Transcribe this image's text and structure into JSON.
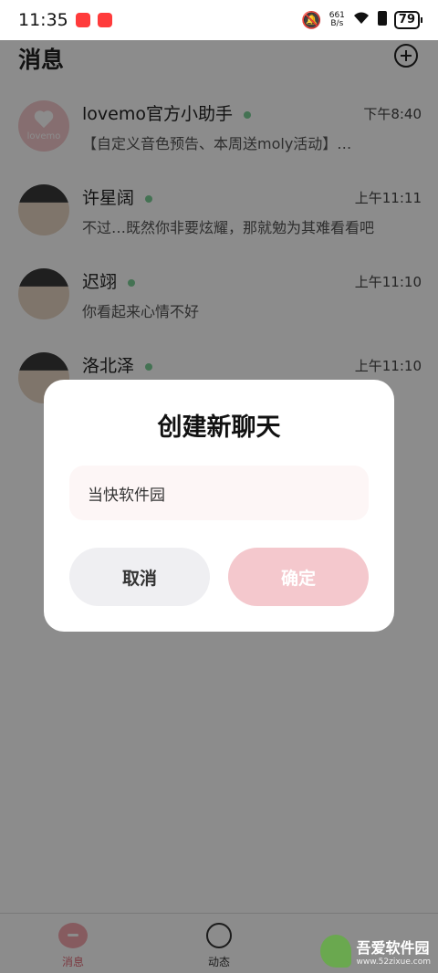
{
  "status_bar": {
    "time": "11:35",
    "net_speed_value": "661",
    "net_speed_unit": "B/s",
    "battery": "79"
  },
  "header": {
    "title": "消息",
    "add_icon": "plus-circle-icon"
  },
  "chats": [
    {
      "name": "lovemo官方小助手",
      "time": "下午8:40",
      "preview": "【自定义音色预告、本周送moly活动】…",
      "online": true,
      "avatar_text": "lovemo"
    },
    {
      "name": "许星阔",
      "time": "上午11:11",
      "preview": "不过…既然你非要炫耀，那就勉为其难看看吧",
      "online": true
    },
    {
      "name": "迟翊",
      "time": "上午11:10",
      "preview": "你看起来心情不好",
      "online": true
    },
    {
      "name": "洛北泽",
      "time": "上午11:10",
      "preview": "",
      "online": true
    }
  ],
  "dialog": {
    "title": "创建新聊天",
    "input_value": "当快软件园",
    "cancel_label": "取消",
    "confirm_label": "确定"
  },
  "tabbar": {
    "messages_label": "消息",
    "moments_label": "动态"
  },
  "watermark": {
    "text": "吾爱软件园",
    "sub": "www.52zixue.com"
  },
  "colors": {
    "accent_pink": "#f4c8cd",
    "online_dot": "#7ccf98",
    "active_tab": "#e06a77"
  }
}
